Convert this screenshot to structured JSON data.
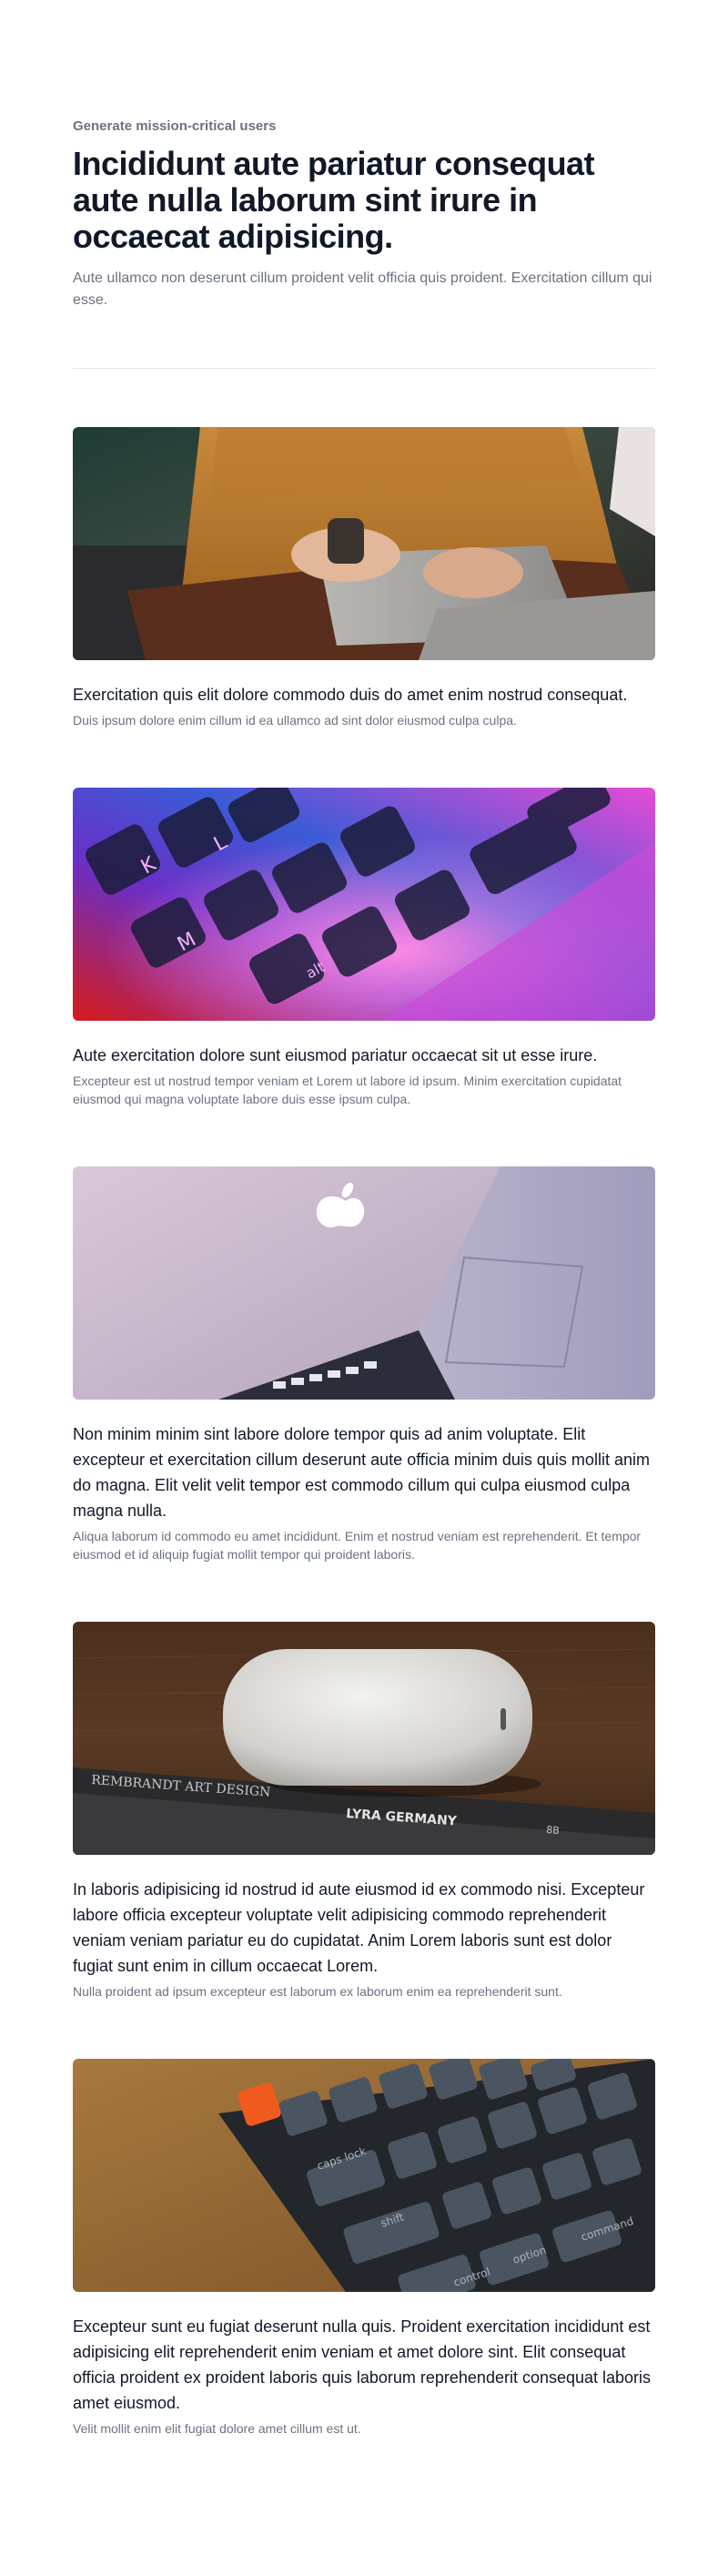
{
  "header": {
    "eyebrow": "Generate mission-critical users",
    "title": "Incididunt aute pariatur consequat aute nulla laborum sint irure in occaecat adipisicing.",
    "subtitle": "Aute ullamco non deserunt cillum proident velit officia quis proident. Exercitation cillum qui esse."
  },
  "posts": [
    {
      "title": "Exercitation quis elit dolore commodo duis do amet enim nostrud consequat.",
      "description": "Duis ipsum dolore enim cillum id ea ullamco ad sint dolor eiusmod culpa culpa.",
      "image": "laptop-typing-photo"
    },
    {
      "title": "Aute exercitation dolore sunt eiusmod pariatur occaecat sit ut esse irure.",
      "description": "Excepteur est ut nostrud tempor veniam et Lorem ut labore id ipsum. Minim exercitation cupidatat eiusmod qui magna voluptate labore duis esse ipsum culpa.",
      "image": "colorful-keyboard-photo"
    },
    {
      "title": "Non minim minim sint labore dolore tempor quis ad anim voluptate. Elit excepteur et exercitation cillum deserunt aute officia minim duis quis mollit anim do magna. Elit velit velit tempor est commodo cillum qui culpa eiusmod culpa magna nulla.",
      "description": "Aliqua laborum id commodo eu amet incididunt. Enim et nostrud veniam est reprehenderit. Et tempor eiusmod et id aliquip fugiat mollit tempor qui proident laboris.",
      "image": "macbook-lid-photo"
    },
    {
      "title": "In laboris adipisicing id nostrud id aute eiusmod id ex commodo nisi. Excepteur labore officia excepteur voluptate velit adipisicing commodo reprehenderit veniam veniam pariatur eu do cupidatat. Anim Lorem laboris sunt est dolor fugiat sunt enim in cillum occaecat Lorem.",
      "description": "Nulla proident ad ipsum excepteur est laborum ex laborum enim ea reprehenderit sunt.",
      "image": "airpods-case-photo",
      "pencil_text_1": "REMBRANDT  ART DESIGN",
      "pencil_text_2": "LYRA  GERMANY",
      "pencil_number": "8B"
    },
    {
      "title": "Excepteur sunt eu fugiat deserunt nulla quis. Proident exercitation incididunt est adipisicing elit reprehenderit enim veniam et amet dolore sint. Elit consequat officia proident ex proident laboris quis laborum reprehenderit consequat laboris amet eiusmod.",
      "description": "Velit mollit enim elit fugiat dolore amet cillum est ut.",
      "image": "mechanical-keyboard-photo"
    }
  ],
  "colors": {
    "heading": "#111827",
    "muted": "#6b7280",
    "divider": "#e5e7eb"
  }
}
